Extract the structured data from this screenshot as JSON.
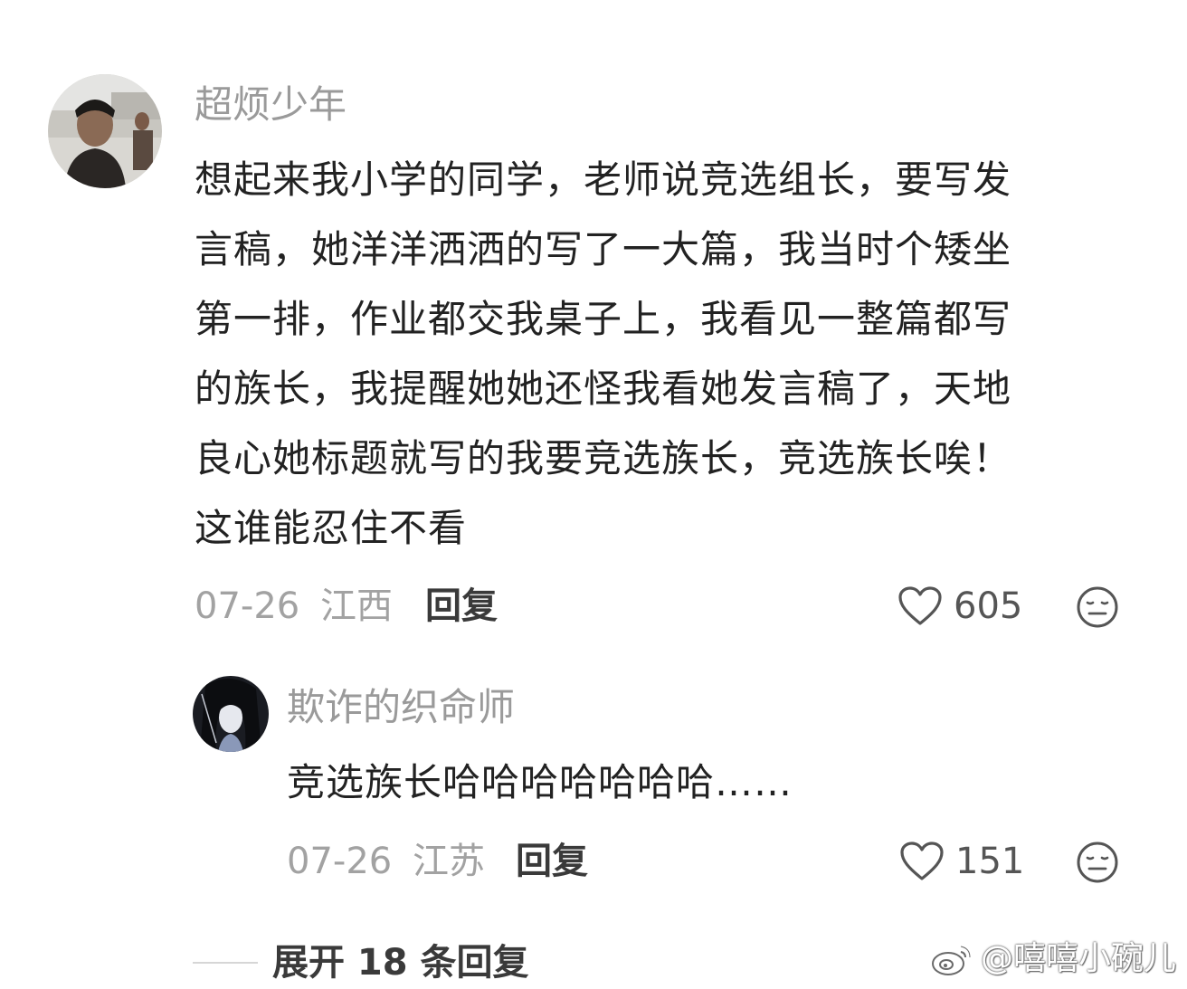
{
  "comment": {
    "username": "超烦少年",
    "text": "想起来我小学的同学，老师说竞选组长，要写发\n言稿，她洋洋洒洒的写了一大篇，我当时个矮坐\n第一排，作业都交我桌子上，我看见一整篇都写\n的族长，我提醒她她还怪我看她发言稿了，天地\n良心她标题就写的我要竞选族长，竞选族长唉！\n这谁能忍住不看",
    "date": "07-26",
    "location": "江西",
    "reply_label": "回复",
    "likes": "605"
  },
  "reply": {
    "username": "欺诈的织命师",
    "text": "竞选族长哈哈哈哈哈哈哈……",
    "date": "07-26",
    "location": "江苏",
    "reply_label": "回复",
    "likes": "151"
  },
  "expand_replies_label": "展开 18 条回复",
  "watermark": {
    "text": "@嘻嘻小碗儿",
    "icon": "weibo-logo-icon"
  },
  "icons": {
    "like": "heart-outline-icon",
    "emoji": "meh-face-icon"
  },
  "colors": {
    "username": "#9a9a9a",
    "body_text": "#222222",
    "meta_text": "#a2a2a2",
    "action_text": "#3a3a3a",
    "icon_stroke": "#555555"
  }
}
